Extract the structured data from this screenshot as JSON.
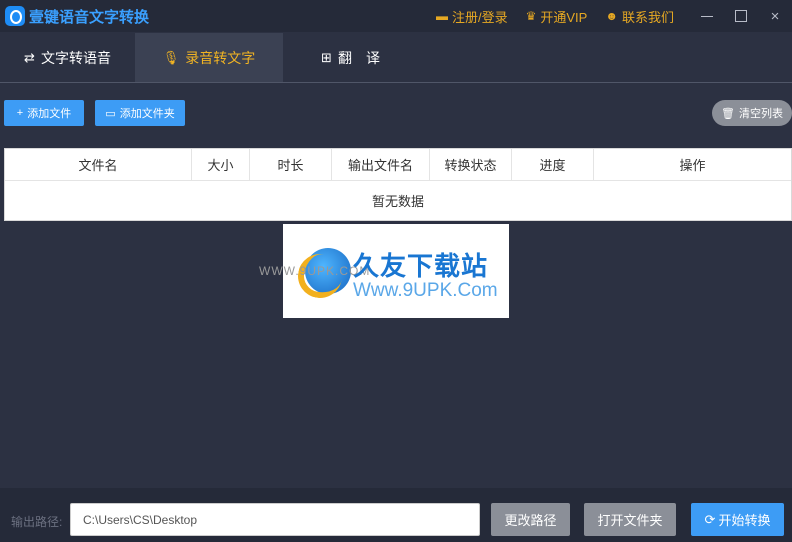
{
  "window": {
    "title": "壹键语音文字转换",
    "links": [
      {
        "icon": "flag-icon",
        "glyph": "▬",
        "label": "注册/登录"
      },
      {
        "icon": "crown-icon",
        "glyph": "♛",
        "label": "开通VIP"
      },
      {
        "icon": "smiley-icon",
        "glyph": "☻",
        "label": "联系我们"
      }
    ],
    "controls": {
      "minimize": "minimize-icon",
      "maximize": "maximize-icon",
      "close": "×"
    }
  },
  "tabs": [
    {
      "icon": "swap-icon",
      "glyph": "⇄",
      "label": "文字转语音",
      "active": false
    },
    {
      "icon": "microphone-icon",
      "glyph": "🎙",
      "label": "录音转文字",
      "active": true
    },
    {
      "icon": "translate-icon",
      "glyph": "⊞",
      "label": "翻　译",
      "active": false
    }
  ],
  "toolbar": {
    "add_file": {
      "icon": "plus-icon",
      "glyph": "+",
      "label": "添加文件"
    },
    "add_folder": {
      "icon": "folder-icon",
      "glyph": "▭",
      "label": "添加文件夹"
    },
    "clear_list": {
      "icon": "trash-icon",
      "glyph": "🗑",
      "label": "清空列表"
    }
  },
  "table": {
    "columns": [
      "文件名",
      "大小",
      "时长",
      "输出文件名",
      "转换状态",
      "进度",
      "操作"
    ],
    "empty_text": "暂无数据"
  },
  "watermark": {
    "url_text": "WWW.9UPK.COM",
    "title": "久友下载站",
    "subtitle": "Www.9UPK.Com"
  },
  "bottom": {
    "output_label": "输出路径:",
    "output_path": "C:\\Users\\CS\\Desktop",
    "change_path": "更改路径",
    "open_folder": "打开文件夹",
    "start": {
      "icon": "refresh-icon",
      "glyph": "⟳",
      "label": "开始转换"
    }
  },
  "colors": {
    "background": "#2c3142",
    "titlebar": "#252a39",
    "accent_blue": "#3d9cf5",
    "accent_gold": "#f0b323",
    "button_gray": "#8b8f98"
  }
}
